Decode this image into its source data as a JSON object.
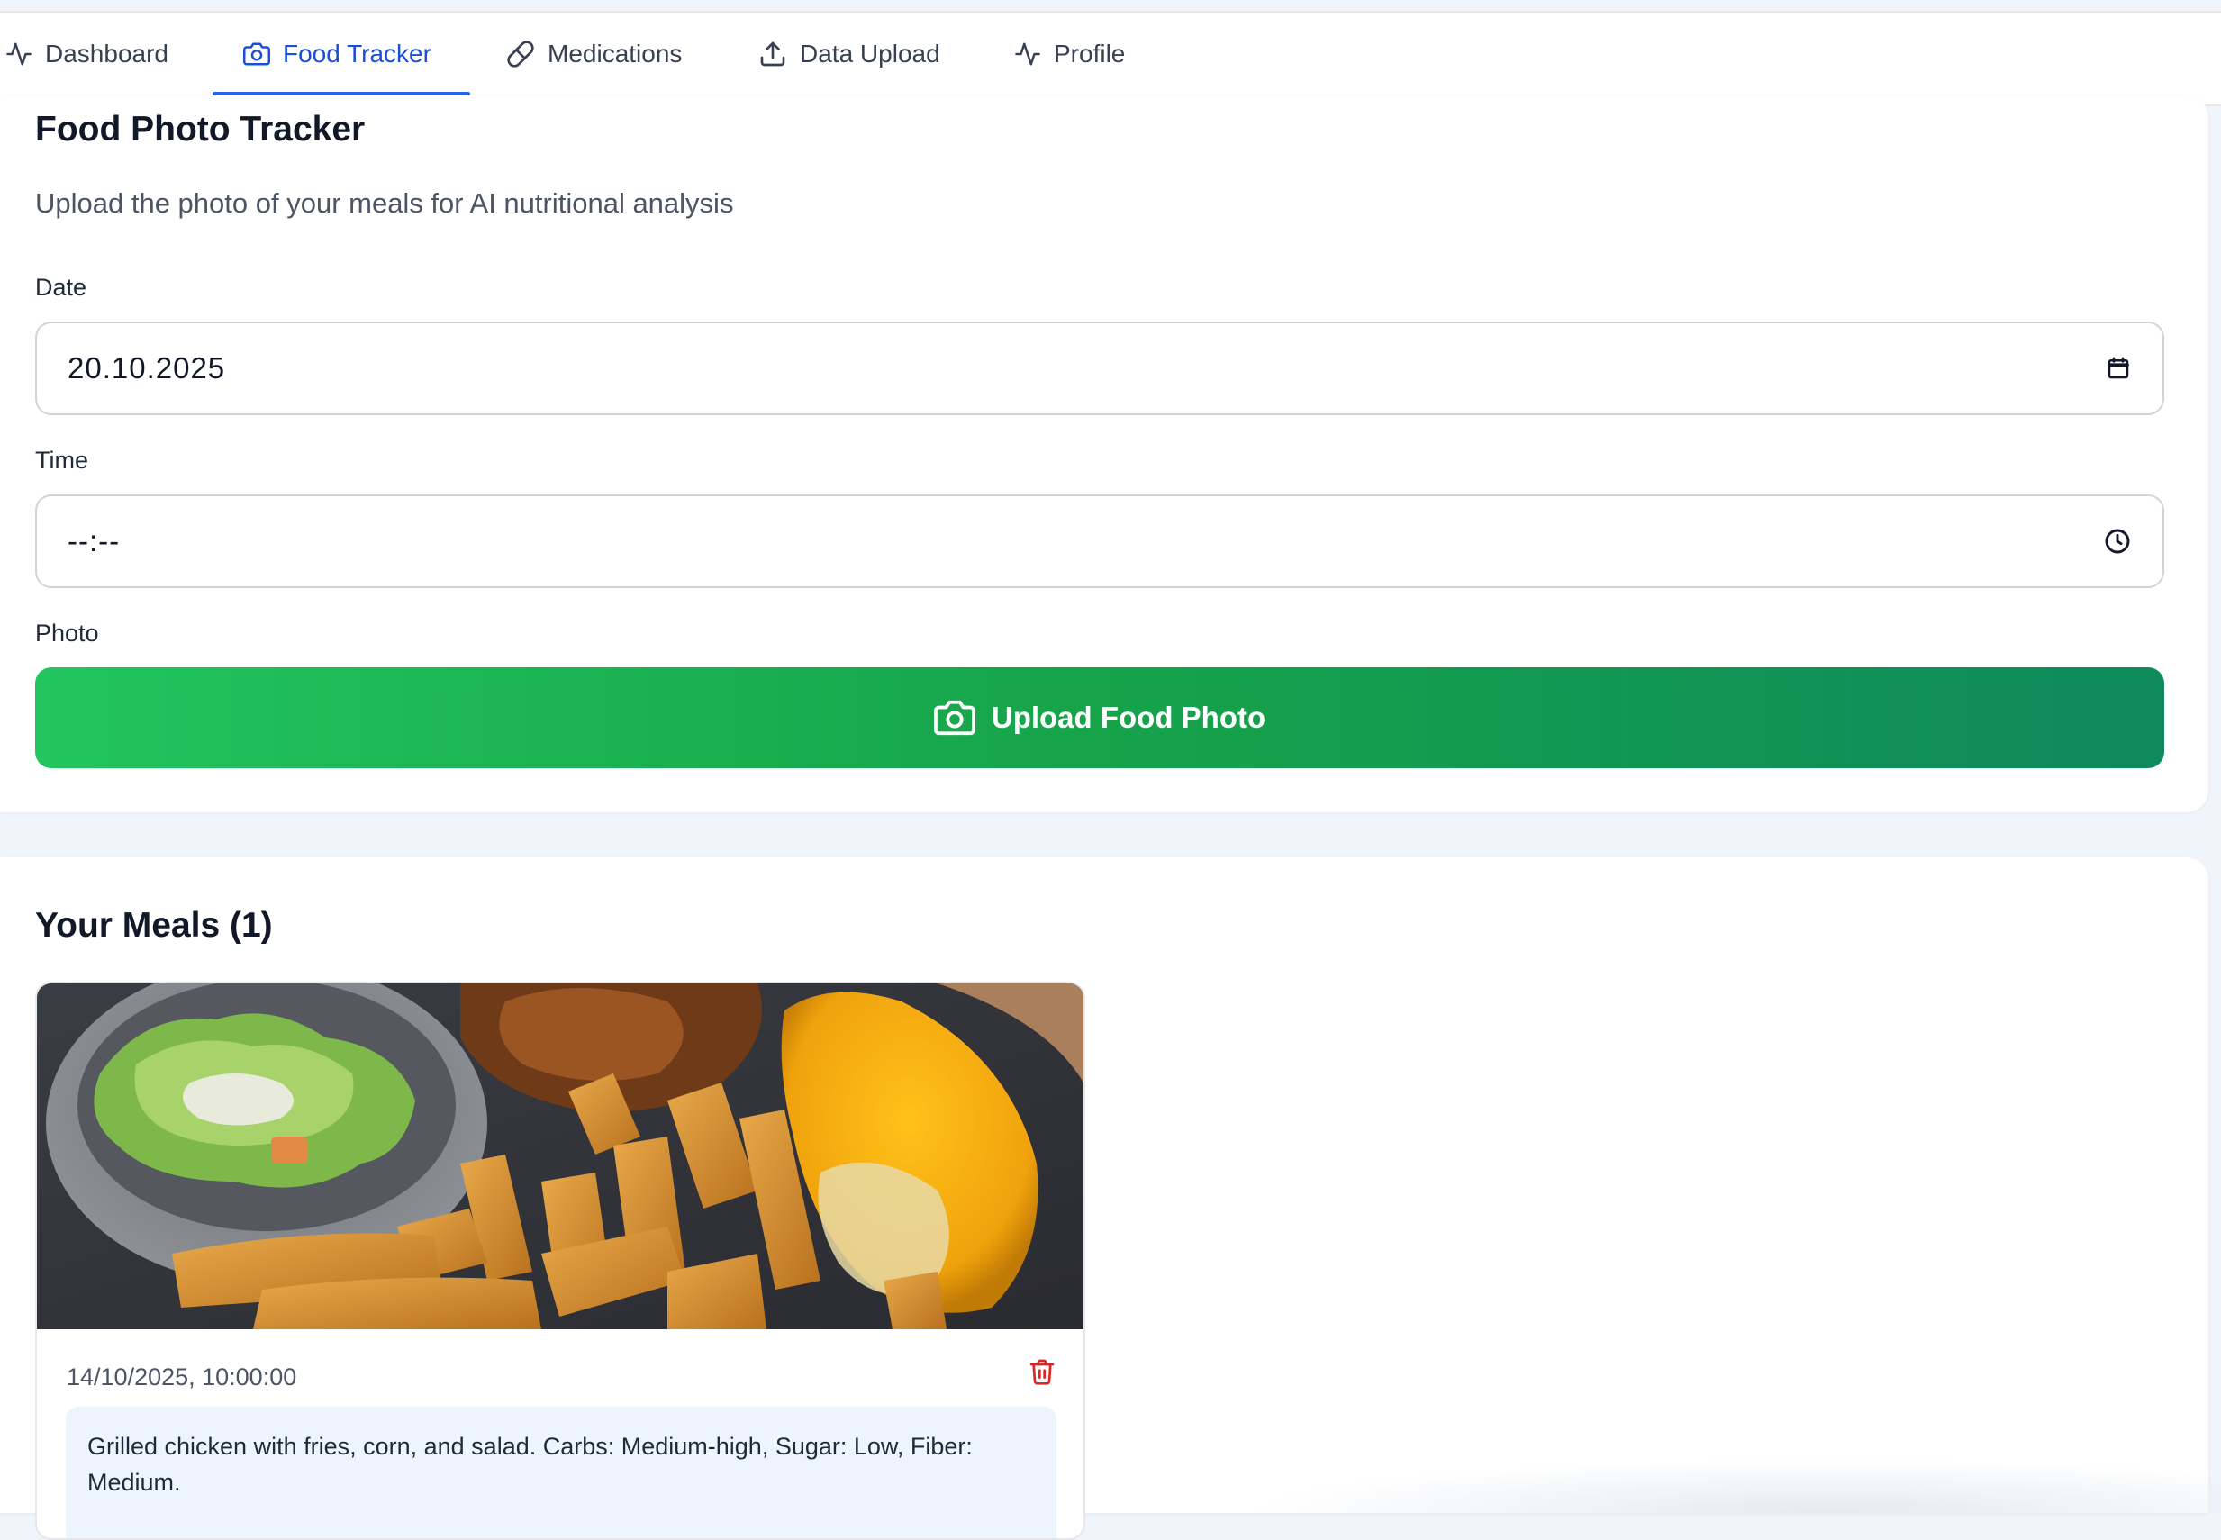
{
  "nav": {
    "tabs": [
      {
        "label": "Dashboard",
        "icon": "activity-icon",
        "active": false
      },
      {
        "label": "Food Tracker",
        "icon": "camera-icon",
        "active": true
      },
      {
        "label": "Medications",
        "icon": "pill-icon",
        "active": false
      },
      {
        "label": "Data Upload",
        "icon": "upload-icon",
        "active": false
      },
      {
        "label": "Profile",
        "icon": "activity-icon",
        "active": false
      }
    ]
  },
  "tracker": {
    "title": "Food Photo Tracker",
    "subtitle": "Upload the photo of your meals for AI nutritional analysis",
    "date_label": "Date",
    "date_value": "20.10.2025",
    "time_label": "Time",
    "time_value": "--:--",
    "photo_label": "Photo",
    "upload_button": "Upload Food Photo"
  },
  "meals": {
    "title": "Your Meals (1)",
    "items": [
      {
        "timestamp": "14/10/2025, 10:00:00",
        "description": "Grilled chicken with fries, corn, and salad. Carbs: Medium-high, Sugar: Low, Fiber: Medium.",
        "photo": "meal-photo"
      }
    ]
  },
  "colors": {
    "accent": "#2563eb",
    "button_start": "#22c55e",
    "button_end": "#0e8a5d",
    "danger": "#dc2626",
    "page_bg": "#f0f5fb"
  }
}
